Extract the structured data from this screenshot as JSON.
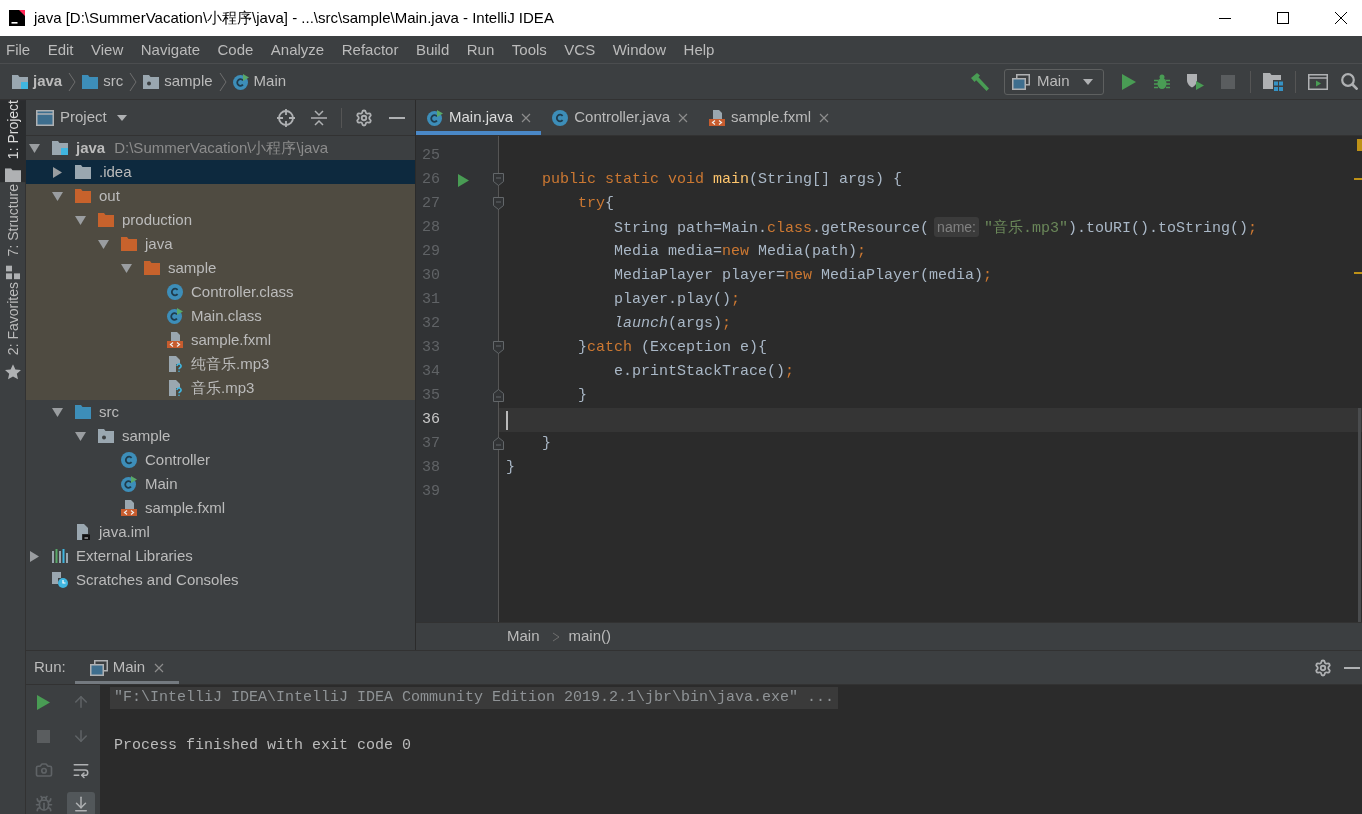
{
  "window": {
    "title": "java [D:\\SummerVacation\\小程序\\java] - ...\\src\\sample\\Main.java - IntelliJ IDEA"
  },
  "menu": [
    "File",
    "Edit",
    "View",
    "Navigate",
    "Code",
    "Analyze",
    "Refactor",
    "Build",
    "Run",
    "Tools",
    "VCS",
    "Window",
    "Help"
  ],
  "navigation_bar": {
    "breadcrumbs": [
      {
        "label": "java",
        "kind": "module"
      },
      {
        "label": "src",
        "kind": "source-folder"
      },
      {
        "label": "sample",
        "kind": "package"
      },
      {
        "label": "Main",
        "kind": "main-class"
      }
    ],
    "run_configuration": "Main"
  },
  "tool_window_tabs": [
    {
      "label": "1: Project",
      "kind": "project",
      "selected": true
    },
    {
      "label": "7: Structure",
      "kind": "structure",
      "selected": false
    },
    {
      "label": "2: Favorites",
      "kind": "favorites",
      "selected": false
    }
  ],
  "project_panel": {
    "title": "Project",
    "tree": [
      {
        "label": "java",
        "detail": "D:\\SummerVacation\\小程序\\java",
        "kind": "module",
        "expanded": true,
        "selected": false,
        "excluded": false,
        "children": [
          {
            "label": ".idea",
            "kind": "folder",
            "expanded": false,
            "selected": true,
            "excluded": false
          },
          {
            "label": "out",
            "kind": "excluded-folder",
            "expanded": true,
            "selected": false,
            "excluded": true,
            "children": [
              {
                "label": "production",
                "kind": "excluded-folder",
                "expanded": true,
                "selected": false,
                "excluded": true,
                "children": [
                  {
                    "label": "java",
                    "kind": "excluded-folder",
                    "expanded": true,
                    "selected": false,
                    "excluded": true,
                    "children": [
                      {
                        "label": "sample",
                        "kind": "excluded-folder",
                        "expanded": true,
                        "selected": false,
                        "excluded": true,
                        "children": [
                          {
                            "label": "Controller.class",
                            "kind": "class",
                            "selected": false,
                            "excluded": true
                          },
                          {
                            "label": "Main.class",
                            "kind": "main-class",
                            "selected": false,
                            "excluded": true
                          },
                          {
                            "label": "sample.fxml",
                            "kind": "fxml",
                            "selected": false,
                            "excluded": true
                          },
                          {
                            "label": "纯音乐.mp3",
                            "kind": "unknown",
                            "selected": false,
                            "excluded": true
                          },
                          {
                            "label": "音乐.mp3",
                            "kind": "unknown",
                            "selected": false,
                            "excluded": true
                          }
                        ]
                      }
                    ]
                  }
                ]
              }
            ]
          },
          {
            "label": "src",
            "kind": "source-folder",
            "expanded": true,
            "selected": false,
            "excluded": false,
            "children": [
              {
                "label": "sample",
                "kind": "package",
                "expanded": true,
                "selected": false,
                "excluded": false,
                "children": [
                  {
                    "label": "Controller",
                    "kind": "class",
                    "selected": false,
                    "excluded": false
                  },
                  {
                    "label": "Main",
                    "kind": "main-class",
                    "selected": false,
                    "excluded": false
                  },
                  {
                    "label": "sample.fxml",
                    "kind": "fxml",
                    "selected": false,
                    "excluded": false
                  }
                ]
              }
            ]
          },
          {
            "label": "java.iml",
            "kind": "iml",
            "selected": false,
            "excluded": false
          }
        ]
      },
      {
        "label": "External Libraries",
        "kind": "libraries",
        "expanded": false,
        "selected": false,
        "excluded": false
      },
      {
        "label": "Scratches and Consoles",
        "kind": "scratches",
        "selected": false,
        "excluded": false
      }
    ]
  },
  "editor": {
    "tabs": [
      {
        "label": "Main.java",
        "kind": "main-class",
        "selected": true
      },
      {
        "label": "Controller.java",
        "kind": "class",
        "selected": false
      },
      {
        "label": "sample.fxml",
        "kind": "fxml",
        "selected": false
      }
    ],
    "lines": [
      {
        "number": "25",
        "current": false,
        "run_marker": false,
        "fold_start": false,
        "fold_end": false
      },
      {
        "number": "26",
        "current": false,
        "run_marker": true,
        "fold_start": true,
        "fold_end": false,
        "tokens": [
          {
            "text": "    public static void ",
            "kind": "keyword"
          },
          {
            "text": "main",
            "kind": "method"
          },
          {
            "text": "(String[] args) {",
            "kind": "plain"
          }
        ]
      },
      {
        "number": "27",
        "current": false,
        "run_marker": false,
        "fold_start": true,
        "fold_end": false,
        "tokens": [
          {
            "text": "        try",
            "kind": "keyword"
          },
          {
            "text": "{",
            "kind": "plain"
          }
        ]
      },
      {
        "number": "28",
        "current": false,
        "run_marker": false,
        "fold_start": false,
        "fold_end": false,
        "tokens": [
          {
            "text": "            String path=Main.",
            "kind": "plain"
          },
          {
            "text": "class",
            "kind": "keyword"
          },
          {
            "text": ".getResource(",
            "kind": "plain"
          },
          {
            "text": "name:",
            "kind": "hint"
          },
          {
            "text": "\"音乐.mp3\"",
            "kind": "string"
          },
          {
            "text": ").toURI().toString()",
            "kind": "plain"
          },
          {
            "text": ";",
            "kind": "keyword"
          }
        ]
      },
      {
        "number": "29",
        "current": false,
        "run_marker": false,
        "fold_start": false,
        "fold_end": false,
        "tokens": [
          {
            "text": "            Media media=",
            "kind": "plain"
          },
          {
            "text": "new",
            "kind": "keyword"
          },
          {
            "text": " Media(path)",
            "kind": "plain"
          },
          {
            "text": ";",
            "kind": "keyword"
          }
        ]
      },
      {
        "number": "30",
        "current": false,
        "run_marker": false,
        "fold_start": false,
        "fold_end": false,
        "tokens": [
          {
            "text": "            MediaPlayer player=",
            "kind": "plain"
          },
          {
            "text": "new",
            "kind": "keyword"
          },
          {
            "text": " MediaPlayer(media)",
            "kind": "plain"
          },
          {
            "text": ";",
            "kind": "keyword"
          }
        ]
      },
      {
        "number": "31",
        "current": false,
        "run_marker": false,
        "fold_start": false,
        "fold_end": false,
        "tokens": [
          {
            "text": "            player.play()",
            "kind": "plain"
          },
          {
            "text": ";",
            "kind": "keyword"
          }
        ]
      },
      {
        "number": "32",
        "current": false,
        "run_marker": false,
        "fold_start": false,
        "fold_end": false,
        "tokens": [
          {
            "text": "            launch",
            "kind": "static"
          },
          {
            "text": "(args)",
            "kind": "plain"
          },
          {
            "text": ";",
            "kind": "keyword"
          }
        ]
      },
      {
        "number": "33",
        "current": false,
        "run_marker": false,
        "fold_start": true,
        "fold_end": false,
        "tokens": [
          {
            "text": "        }",
            "kind": "plain"
          },
          {
            "text": "catch",
            "kind": "keyword"
          },
          {
            "text": " (Exception e){",
            "kind": "plain"
          }
        ]
      },
      {
        "number": "34",
        "current": false,
        "run_marker": false,
        "fold_start": false,
        "fold_end": false,
        "tokens": [
          {
            "text": "            e.printStackTrace()",
            "kind": "plain"
          },
          {
            "text": ";",
            "kind": "keyword"
          }
        ]
      },
      {
        "number": "35",
        "current": false,
        "run_marker": false,
        "fold_start": false,
        "fold_end": true,
        "tokens": [
          {
            "text": "        }",
            "kind": "plain"
          }
        ]
      },
      {
        "number": "36",
        "current": true,
        "run_marker": false,
        "fold_start": false,
        "fold_end": false
      },
      {
        "number": "37",
        "current": false,
        "run_marker": false,
        "fold_start": false,
        "fold_end": true,
        "tokens": [
          {
            "text": "    }",
            "kind": "plain"
          }
        ]
      },
      {
        "number": "38",
        "current": false,
        "run_marker": false,
        "fold_start": false,
        "fold_end": false,
        "tokens": [
          {
            "text": "}",
            "kind": "plain"
          }
        ]
      },
      {
        "number": "39",
        "current": false,
        "run_marker": false,
        "fold_start": false,
        "fold_end": false
      }
    ],
    "breadcrumbs": [
      "Main",
      "main()"
    ]
  },
  "run_panel": {
    "label": "Run:",
    "tabs": [
      {
        "label": "Main",
        "selected": true
      }
    ],
    "soft_wrap": false,
    "scroll_to_end": true,
    "console": [
      {
        "kind": "command",
        "text": "\"F:\\IntelliJ IDEA\\IntelliJ IDEA Community Edition 2019.2.1\\jbr\\bin\\java.exe\" ..."
      },
      {
        "kind": "blank"
      },
      {
        "kind": "output",
        "text": "Process finished with exit code 0"
      }
    ]
  }
}
